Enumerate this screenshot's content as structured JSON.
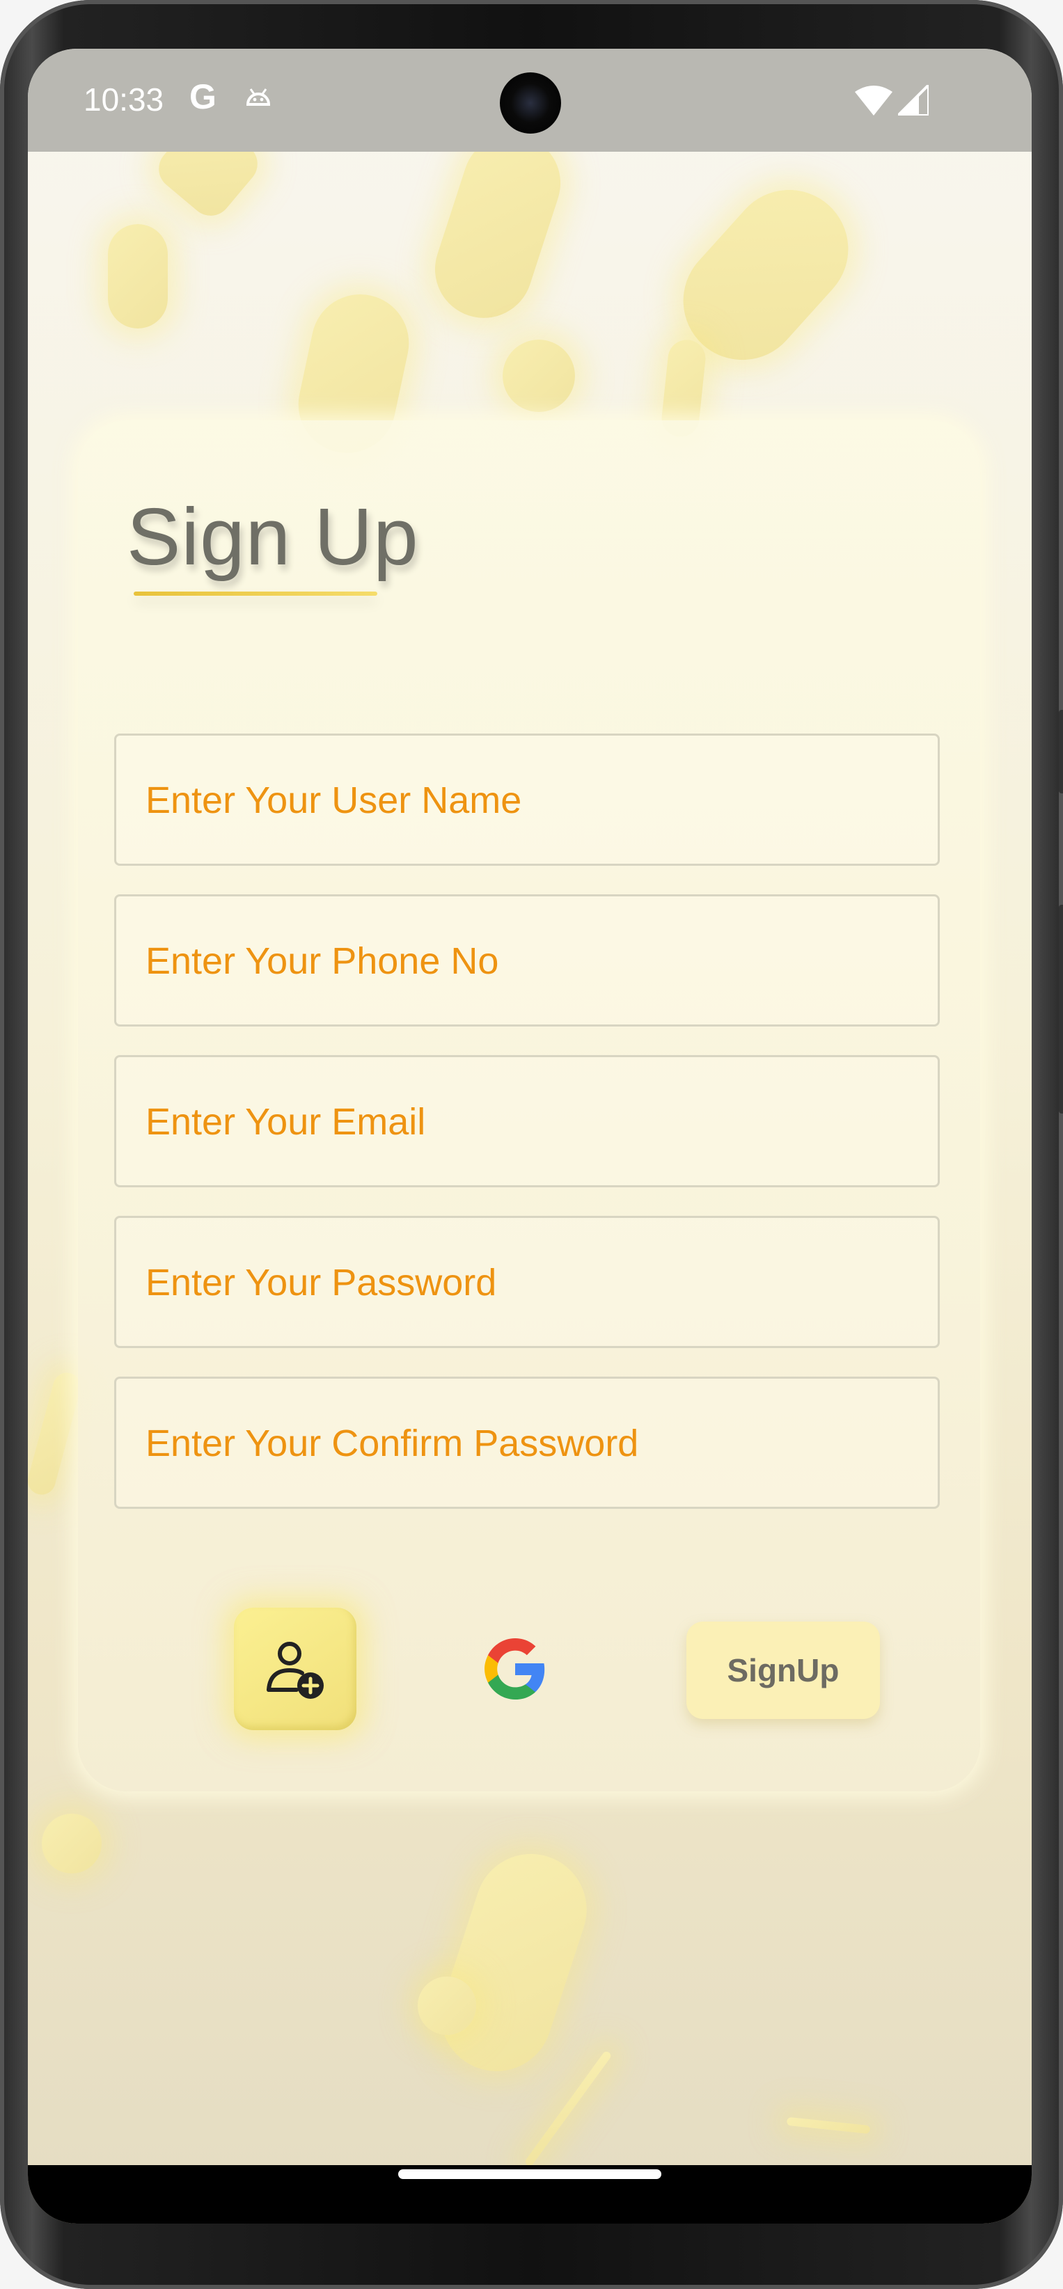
{
  "status_bar": {
    "time": "10:33",
    "g_label": "G"
  },
  "signup": {
    "title": "Sign Up",
    "fields": [
      {
        "placeholder": "Enter Your User Name"
      },
      {
        "placeholder": "Enter Your Phone No"
      },
      {
        "placeholder": "Enter Your Email"
      },
      {
        "placeholder": "Enter Your Password"
      },
      {
        "placeholder": "Enter Your Confirm Password"
      }
    ],
    "signup_label": "SignUp",
    "icons": {
      "add_user": "add-user-icon",
      "google": "google-icon"
    }
  },
  "colors": {
    "accent": "#ee9311",
    "title": "#6f6f66",
    "underline": "#e8c23a",
    "button_yellow": "#f7ea86"
  }
}
